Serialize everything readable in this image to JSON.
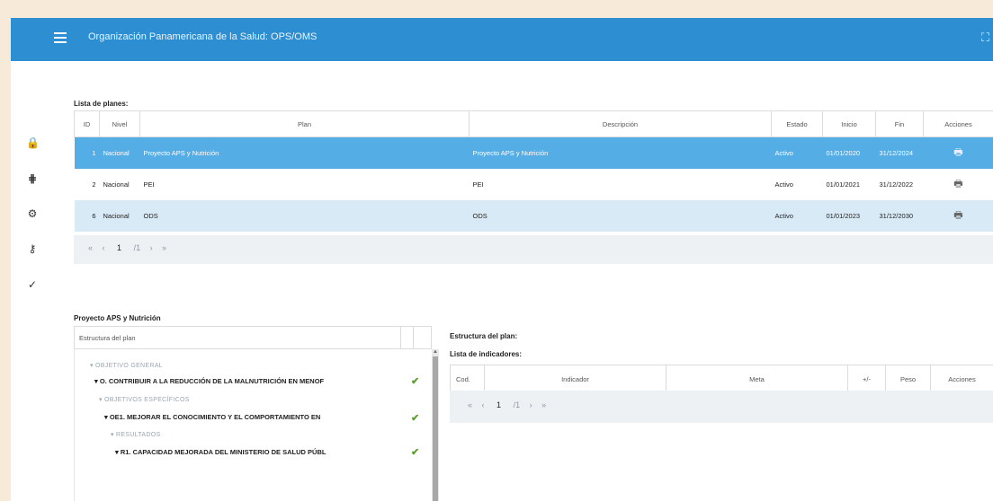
{
  "app": {
    "title": "Organización Panamericana de la Salud: OPS/OMS",
    "menu_icon": "hamburger-menu-icon",
    "fullscreen_icon": "fullscreen-icon"
  },
  "sidebar": {
    "items": [
      {
        "icon": "lock-icon",
        "glyph": "🔒"
      },
      {
        "icon": "grid-icon",
        "glyph": "⋕"
      },
      {
        "icon": "gear-icon",
        "glyph": "⚙"
      },
      {
        "icon": "key-icon",
        "glyph": "⚷"
      },
      {
        "icon": "check-icon",
        "glyph": "✓"
      }
    ]
  },
  "plans": {
    "label": "Lista de planes:",
    "columns": [
      "ID",
      "Nivel",
      "Plan",
      "Descripción",
      "Estado",
      "Inicio",
      "Fin",
      "Acciones"
    ],
    "rows": [
      {
        "id": "1",
        "nivel": "Nacional",
        "plan": "Proyecto APS y Nutrición",
        "descripcion": "Proyecto APS y Nutrición",
        "estado": "Activo",
        "inicio": "01/01/2020",
        "fin": "31/12/2024",
        "accion_icon": "print-icon"
      },
      {
        "id": "2",
        "nivel": "Nacional",
        "plan": "PEI",
        "descripcion": "PEI",
        "estado": "Activo",
        "inicio": "01/01/2021",
        "fin": "31/12/2022",
        "accion_icon": "print-icon"
      },
      {
        "id": "6",
        "nivel": "Nacional",
        "plan": "ODS",
        "descripcion": "ODS",
        "estado": "Activo",
        "inicio": "01/01/2023",
        "fin": "31/12/2030",
        "accion_icon": "print-icon"
      }
    ],
    "pager": {
      "first": "«",
      "prev": "‹",
      "page": "1",
      "total": "/1",
      "next": "›",
      "last": "»"
    }
  },
  "tree": {
    "label": "Proyecto APS y Nutrición",
    "header": "Estructura del plan",
    "nodes": [
      {
        "text": "▾ OBJETIVO GENERAL",
        "muted": true,
        "check": false
      },
      {
        "text": "▾ O. CONTRIBUIR A LA REDUCCIÓN DE LA MALNUTRICIÓN EN MENOF",
        "muted": false,
        "check": true
      },
      {
        "text": "▾ OBJETIVOS ESPECÍFICOS",
        "muted": true,
        "check": false
      },
      {
        "text": "▾ OE1. MEJORAR EL CONOCIMIENTO Y EL COMPORTAMIENTO EN",
        "muted": false,
        "check": true
      },
      {
        "text": "▾ RESULTADOS",
        "muted": true,
        "check": false
      },
      {
        "text": "▾ R1. CAPACIDAD MEJORADA DEL MINISTERIO DE SALUD PÚBL",
        "muted": false,
        "check": true
      }
    ],
    "check_glyph": "✔"
  },
  "structure": {
    "label": "Estructura del plan:"
  },
  "indicators": {
    "label": "Lista de indicadores:",
    "columns": [
      "Cod.",
      "Indicador",
      "Meta",
      "+/-",
      "Peso",
      "Acciones"
    ],
    "pager": {
      "first": "«",
      "prev": "‹",
      "page": "1",
      "total": "/1",
      "next": "›",
      "last": "»"
    }
  }
}
